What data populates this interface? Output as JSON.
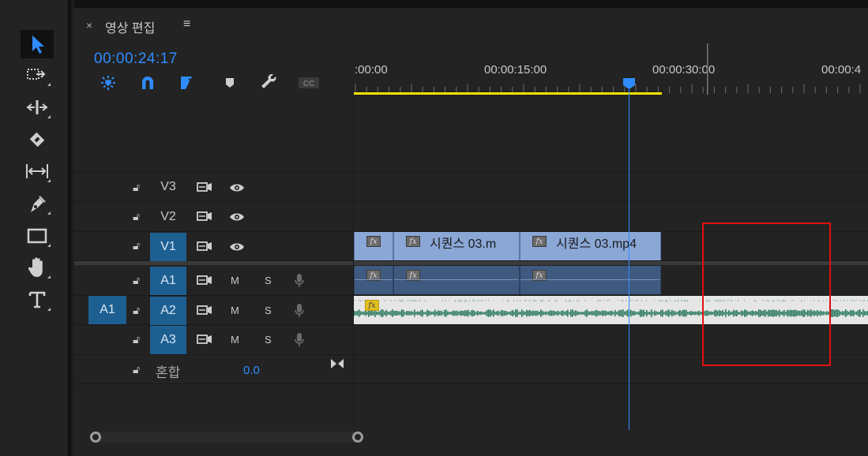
{
  "panel": {
    "close_symbol": "×",
    "title": "영상 편집",
    "menu_symbol": "≡",
    "timecode": "00:00:24:17"
  },
  "toolbar_icons": [
    "nest-icon",
    "magnet-snap-icon",
    "linked-selection-icon",
    "marker-icon",
    "wrench-icon",
    "captions-icon"
  ],
  "tools": [
    "selection-tool-icon",
    "track-select-tool-icon",
    "ripple-edit-tool-icon",
    "razor-tool-icon",
    "slip-tool-icon",
    "pen-tool-icon",
    "rectangle-tool-icon",
    "hand-tool-icon",
    "type-tool-icon"
  ],
  "ruler": {
    "labels": [
      ":00:00",
      "00:00:15:00",
      "00:00:30:00",
      "00:00:4"
    ]
  },
  "tracks": {
    "video": [
      {
        "name": "V3",
        "selected": false
      },
      {
        "name": "V2",
        "selected": false
      },
      {
        "name": "V1",
        "selected": true
      }
    ],
    "audio": [
      {
        "name": "A1",
        "m": "M",
        "s": "S"
      },
      {
        "name": "A2",
        "m": "M",
        "s": "S"
      },
      {
        "name": "A3",
        "m": "M",
        "s": "S"
      }
    ],
    "source_patch": "A1",
    "mix": {
      "label": "혼합",
      "value": "0.0"
    }
  },
  "clips": {
    "fx_label": "fx",
    "video": [
      {
        "title": ""
      },
      {
        "title": "시퀀스 03.m"
      },
      {
        "title": "시퀀스 03.mp4"
      }
    ]
  },
  "colors": {
    "accent": "#2f8cff",
    "selected_track": "#1e5f92",
    "work_area_bar": "#f2e400",
    "video_clip": "#8aa7d6",
    "audio_clip": "#3f5a80",
    "waveform": "#2c7a5e",
    "highlight_box": "#e01010"
  }
}
